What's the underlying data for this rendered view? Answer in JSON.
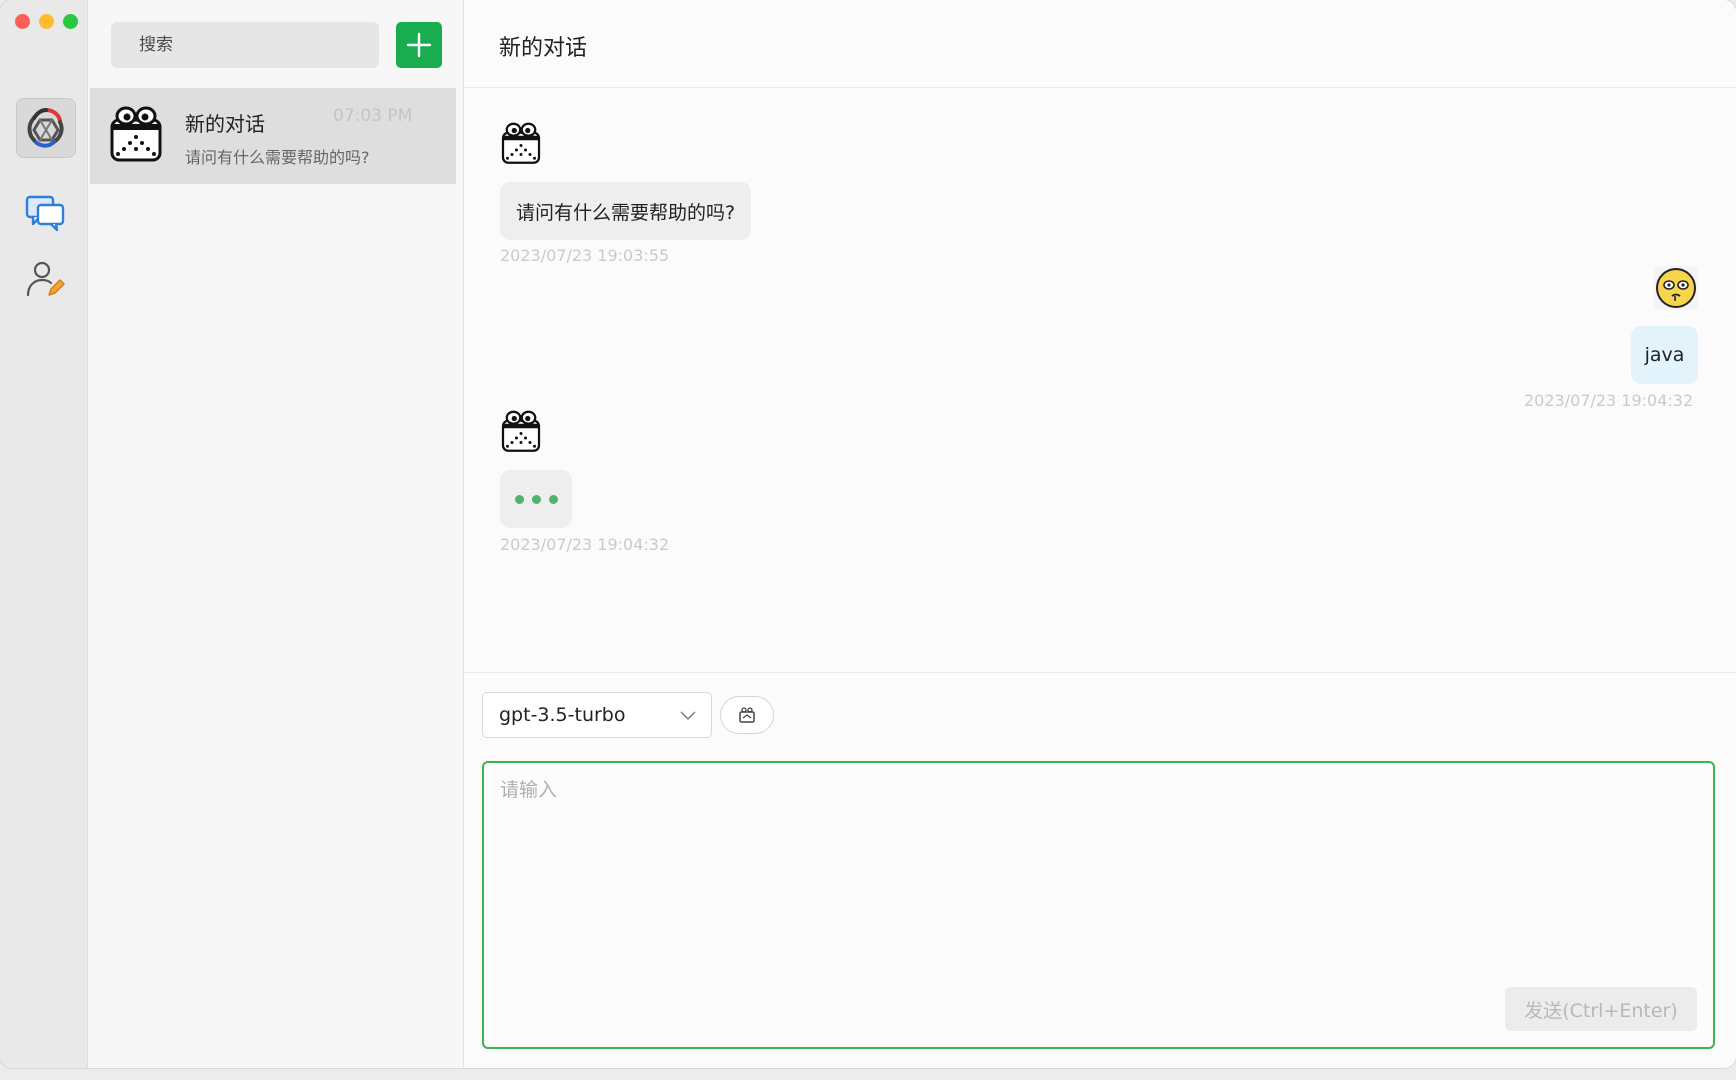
{
  "window": {
    "traffic_colors": [
      "#fe5f57",
      "#febc2e",
      "#28c840"
    ]
  },
  "rail": {
    "items": [
      {
        "name": "app-logo",
        "icon": "openai-logo-icon"
      },
      {
        "name": "chats",
        "icon": "chat-bubbles-icon",
        "color": "#2e7fd8"
      },
      {
        "name": "profile",
        "icon": "user-edit-icon",
        "color": "#555555"
      }
    ]
  },
  "list": {
    "search_placeholder": "搜索",
    "add_icon": "plus-icon",
    "accent": "#1aad4f",
    "conversations": [
      {
        "title": "新的对话",
        "time": "07:03 PM",
        "preview": "请问有什么需要帮助的吗?"
      }
    ]
  },
  "chat": {
    "title": "新的对话",
    "messages": [
      {
        "role": "assistant",
        "text": "请问有什么需要帮助的吗?",
        "time": "2023/07/23 19:03:55"
      },
      {
        "role": "user",
        "text": "java",
        "time": "2023/07/23 19:04:32"
      },
      {
        "role": "assistant",
        "text": "",
        "typing": true,
        "time": "2023/07/23 19:04:32"
      }
    ]
  },
  "composer": {
    "model": "gpt-3.5-turbo",
    "tool_icon": "robot-icon",
    "input_placeholder": "请输入",
    "send_label": "发送(Ctrl+Enter)",
    "focus_color": "#3cb354"
  }
}
